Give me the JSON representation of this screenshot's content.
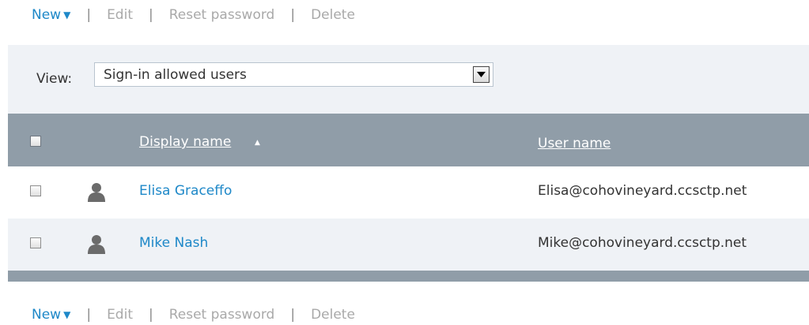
{
  "toolbar_top": {
    "new_label": "New",
    "new_caret": "▼",
    "sep": "|",
    "edit_label": "Edit",
    "reset_label": "Reset password",
    "delete_label": "Delete"
  },
  "view": {
    "label": "View:",
    "selected": "Sign-in allowed users"
  },
  "table": {
    "col_display": "Display name",
    "sort_indicator": "▲",
    "col_user": "User name",
    "rows": [
      {
        "display_name": "Elisa Graceffo",
        "user_name": "Elisa@cohovineyard.ccsctp.net"
      },
      {
        "display_name": "Mike Nash",
        "user_name": "Mike@cohovineyard.ccsctp.net"
      }
    ]
  },
  "toolbar_bottom": {
    "new_label": "New",
    "new_caret": "▼",
    "sep": "|",
    "edit_label": "Edit",
    "reset_label": "Reset password",
    "delete_label": "Delete"
  },
  "icons": {
    "user": "user-icon",
    "dropdown": "chevron-down-icon",
    "sort": "sort-ascending-icon"
  },
  "colors": {
    "accent": "#1e88c8",
    "header_bg": "#909da8",
    "panel_bg": "#eff2f6",
    "disabled_text": "#a9a9a9"
  }
}
